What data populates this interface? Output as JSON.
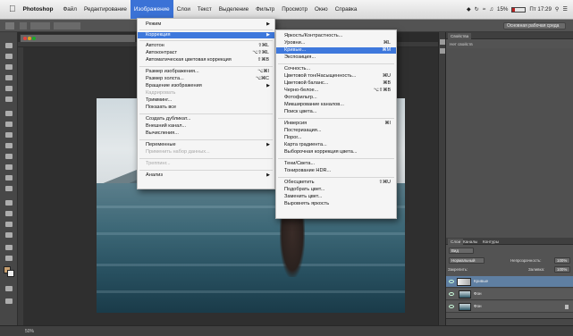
{
  "menubar": {
    "app_name": "Photoshop",
    "items": [
      "Файл",
      "Редактирование",
      "Изображение",
      "Слои",
      "Текст",
      "Выделение",
      "Фильтр",
      "Просмотр",
      "Окно",
      "Справка"
    ],
    "active_index": 2,
    "status_right": {
      "battery_pct": "15%",
      "day_time": "Пт 17:29"
    }
  },
  "options_bar": {
    "workspace": "Основная рабочая среда"
  },
  "image_menu": {
    "items": [
      {
        "label": "Режим",
        "submenu": true
      },
      {
        "label": "Коррекция",
        "submenu": true,
        "selected": true
      },
      {
        "label": "Автотон",
        "shortcut": "⇧⌘L"
      },
      {
        "label": "Автоконтраст",
        "shortcut": "⌥⇧⌘L"
      },
      {
        "label": "Автоматическая цветовая коррекция",
        "shortcut": "⇧⌘B"
      },
      {
        "label": "Размер изображения...",
        "shortcut": "⌥⌘I"
      },
      {
        "label": "Размер холста...",
        "shortcut": "⌥⌘C"
      },
      {
        "label": "Вращение изображения",
        "submenu": true
      },
      {
        "label": "Кадрировать",
        "disabled": true
      },
      {
        "label": "Тримминг..."
      },
      {
        "label": "Показать все"
      },
      {
        "label": "Создать дубликат..."
      },
      {
        "label": "Внешний канал..."
      },
      {
        "label": "Вычисления..."
      },
      {
        "label": "Переменные",
        "submenu": true
      },
      {
        "label": "Применить набор данных...",
        "disabled": true
      },
      {
        "label": "Треппинг...",
        "disabled": true
      },
      {
        "label": "Анализ",
        "submenu": true
      }
    ]
  },
  "adjust_menu": {
    "items": [
      {
        "label": "Яркость/Контрастность..."
      },
      {
        "label": "Уровни...",
        "shortcut": "⌘L"
      },
      {
        "label": "Кривые...",
        "shortcut": "⌘M",
        "selected": true
      },
      {
        "label": "Экспозиция..."
      },
      {
        "label": "Сочность..."
      },
      {
        "label": "Цветовой тон/Насыщенность...",
        "shortcut": "⌘U"
      },
      {
        "label": "Цветовой баланс...",
        "shortcut": "⌘B"
      },
      {
        "label": "Черно-белое...",
        "shortcut": "⌥⇧⌘B"
      },
      {
        "label": "Фотофильтр..."
      },
      {
        "label": "Микширование каналов..."
      },
      {
        "label": "Поиск цвета..."
      },
      {
        "label": "Инверсия",
        "shortcut": "⌘I"
      },
      {
        "label": "Постеризация..."
      },
      {
        "label": "Порог..."
      },
      {
        "label": "Карта градиента..."
      },
      {
        "label": "Выборочная коррекция цвета..."
      },
      {
        "label": "Тени/Света..."
      },
      {
        "label": "Тонирование HDR..."
      },
      {
        "label": "Обесцветить",
        "shortcut": "⇧⌘U"
      },
      {
        "label": "Подобрать цвет..."
      },
      {
        "label": "Заменить цвет..."
      },
      {
        "label": "Выровнять яркость"
      }
    ]
  },
  "properties_panel": {
    "tab": "Свойства",
    "note": "Нет свойств"
  },
  "layers_panel": {
    "tabs": [
      "Слои",
      "Каналы",
      "Контуры"
    ],
    "filter": "Вид",
    "blend_mode": "Нормальный",
    "opacity_label": "Непрозрачность:",
    "opacity_value": "100%",
    "lock_label": "Закрепить:",
    "fill_label": "Заливка:",
    "fill_value": "100%",
    "layers": [
      {
        "name": "Кривые",
        "selected": true,
        "mask": true
      },
      {
        "name": "Фон"
      },
      {
        "name": "Фон"
      }
    ]
  },
  "statusbar": {
    "zoom": "50%"
  },
  "colors": {
    "menu_highlight": "#3e78dc",
    "ps_panel": "#535353",
    "ps_dark": "#2b2b2b"
  }
}
